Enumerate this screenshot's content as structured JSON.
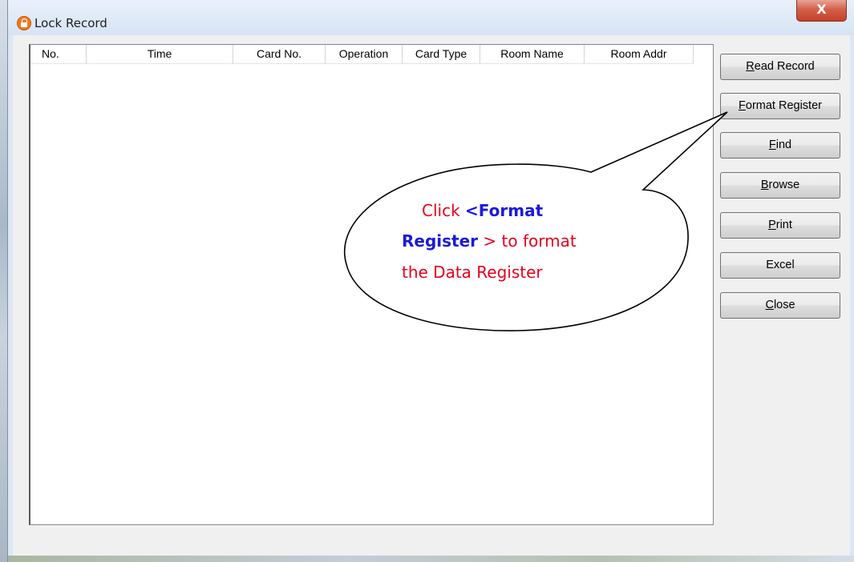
{
  "window": {
    "title": "Lock Record",
    "close_symbol": "X"
  },
  "list": {
    "columns": [
      "No.",
      "Time",
      "Card No.",
      "Operation",
      "Card Type",
      "Room Name",
      "Room Addr"
    ],
    "rows": []
  },
  "buttons": [
    {
      "pre": "",
      "u": "R",
      "post": "ead Record"
    },
    {
      "pre": "",
      "u": "F",
      "post": "ormat Register"
    },
    {
      "pre": "",
      "u": "F",
      "post": "ind"
    },
    {
      "pre": "",
      "u": "B",
      "post": "rowse"
    },
    {
      "pre": "",
      "u": "P",
      "post": "rint"
    },
    {
      "pre": "Excel",
      "u": "",
      "post": ""
    },
    {
      "pre": "",
      "u": "C",
      "post": "lose"
    }
  ],
  "callout": {
    "line1_red": "Click ",
    "line1_blue": "<Format",
    "line2_blue": "Register",
    "line2_red": " > to format",
    "line3_red": "the Data Register"
  },
  "colors": {
    "callout_red": "#e8001c",
    "callout_blue": "#1a1adb",
    "close_button": "#c4402a",
    "title_icon": "#f07a1f"
  },
  "icons": {
    "title_icon": "lock-icon",
    "close_icon": "close-icon"
  }
}
